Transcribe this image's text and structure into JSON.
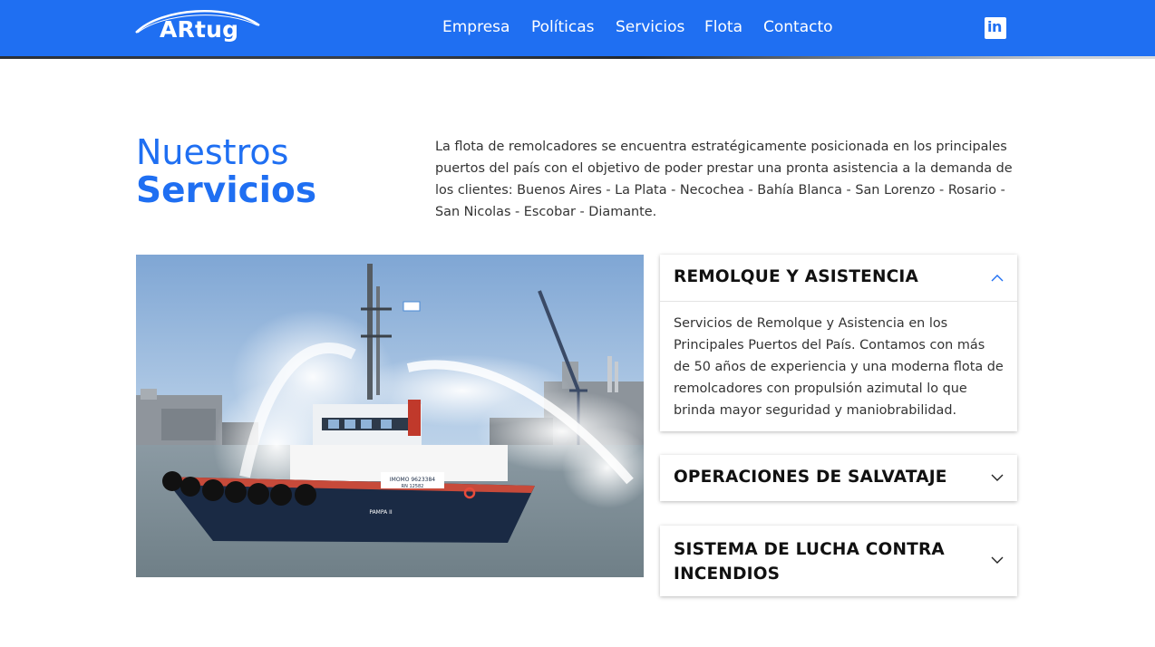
{
  "header": {
    "logo_text": "ARtug",
    "nav": [
      "Empresa",
      "Políticas",
      "Servicios",
      "Flota",
      "Contacto"
    ],
    "social_icon": "linkedin-icon",
    "social_label": "in"
  },
  "section": {
    "title_light": "Nuestros",
    "title_bold": "Servicios",
    "intro": "La flota de remolcadores se encuentra estratégicamente posicionada en los principales puertos del país con el objetivo de poder prestar una pronta asistencia a la demanda de los clientes: Buenos Aires - La Plata - Necochea - Bahía Blanca - San Lorenzo - Rosario - San Nicolas - Escobar - Diamante."
  },
  "accordion": [
    {
      "title": "REMOLQUE Y ASISTENCIA",
      "expanded": true,
      "body": "Servicios de Remolque y Asistencia en los Principales Puertos del País. Contamos con más de 50 años de experiencia y una moderna flota de remolcadores con propulsión azimutal lo que brinda mayor seguridad y maniobrabilidad."
    },
    {
      "title": "OPERACIONES DE SALVATAJE",
      "expanded": false
    },
    {
      "title": "SISTEMA DE LUCHA CONTRA INCENDIOS",
      "expanded": false
    }
  ],
  "photo": {
    "hull_marking_1": "IMOMO 9623384",
    "hull_marking_2": "RN 12582",
    "vessel_name": "PAMPA II"
  },
  "colors": {
    "brand_blue": "#1f6ff2",
    "heading_text": "#111111",
    "body_text": "#333333"
  }
}
